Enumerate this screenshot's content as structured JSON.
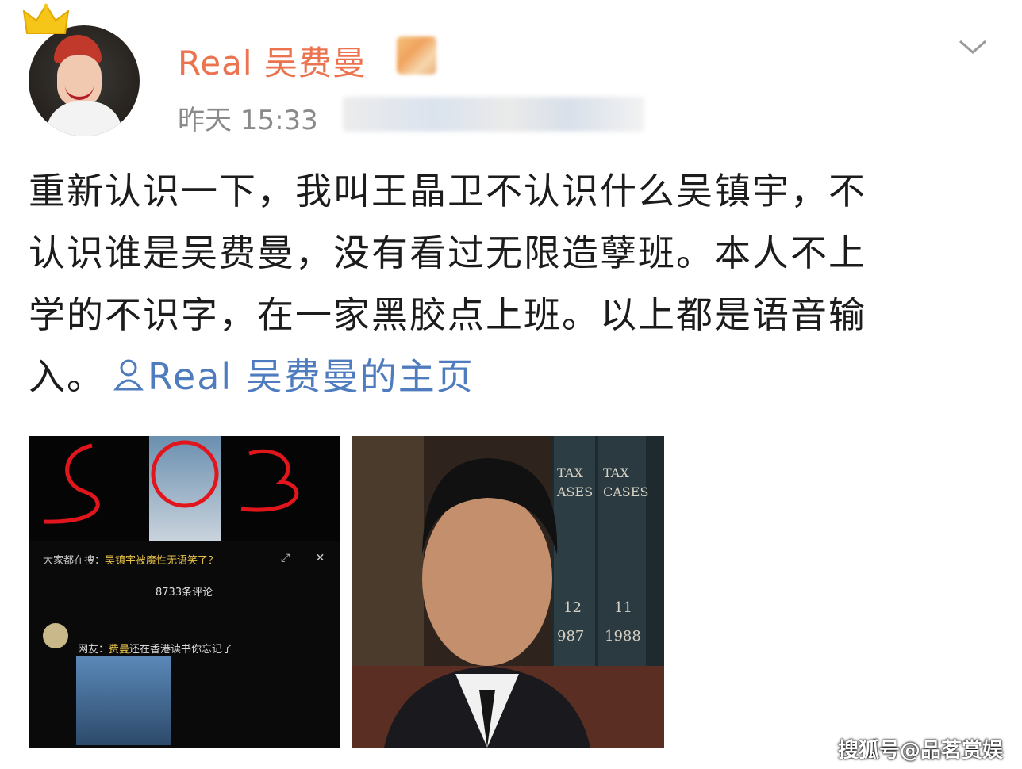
{
  "header": {
    "username": "Real 吴费曼",
    "timestamp": "昨天 15:33"
  },
  "post": {
    "lines": [
      "重新认识一下，我叫王晶卫不认识什么吴镇宇，不",
      "认识谁是吴费曼，没有看过无限造孽班。本人不上",
      "学的不识字，在一家黑胶点上班。以上都是语音输"
    ],
    "last_line_prefix": "入。",
    "profile_link": "Real 吴费曼的主页"
  },
  "photo_left": {
    "comments_title_prefix": "大家都在搜：",
    "comments_title_highlight": "吴镇宇被魔性无语笑了？",
    "comment_count": "8733条评论",
    "comment_prefix": "网友：",
    "comment_highlight": "费曼",
    "comment_text": "还在香港读书你忘记了",
    "book_label_1": "TAX CASES",
    "book_label_2": "TAX CASES",
    "book_year_1": "1987",
    "book_year_2": "1988",
    "book_vol_1": "12",
    "book_vol_2": "11"
  },
  "watermark": "搜狐号@品茗赏娱",
  "icons": {
    "crown": "crown-icon",
    "chevron": "chevron-down-icon",
    "person": "person-icon",
    "close": "close-icon"
  },
  "colors": {
    "username": "#eb7350",
    "link": "#4f7cbf",
    "timestamp": "#8a8a8a"
  }
}
